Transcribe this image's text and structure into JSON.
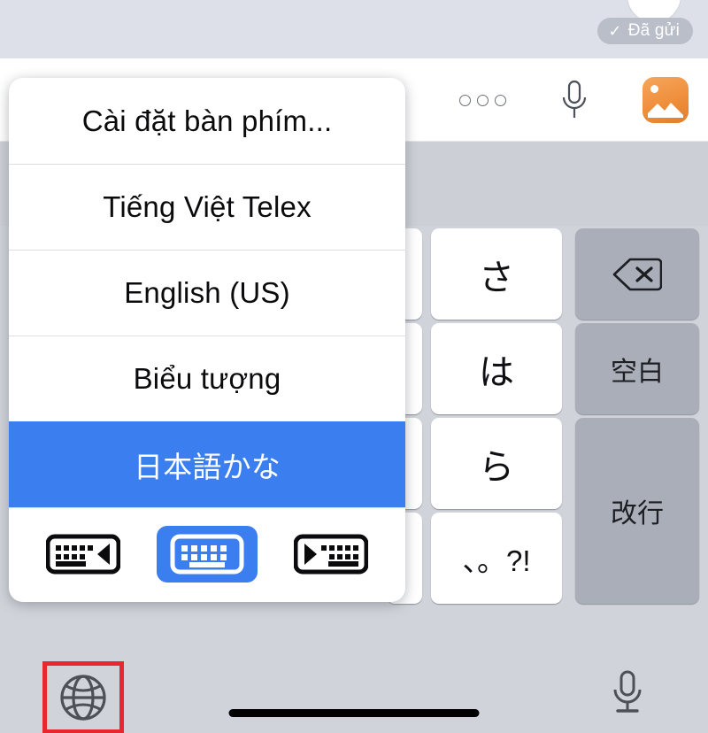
{
  "chat": {
    "status_badge": {
      "check_icon": "check-icon",
      "label": "Đã gửi"
    },
    "avatar": "avatar"
  },
  "toolbar": {
    "more_icon": "more-options-icon",
    "mic_icon": "microphone-icon",
    "photo_icon": "photo-gallery-icon"
  },
  "popup": {
    "items": [
      {
        "label": "Cài đặt bàn phím...",
        "selected": false
      },
      {
        "label": "Tiếng Việt Telex",
        "selected": false
      },
      {
        "label": "English (US)",
        "selected": false
      },
      {
        "label": "Biểu tượng",
        "selected": false
      },
      {
        "label": "日本語かな",
        "selected": true
      }
    ],
    "layout_buttons": [
      {
        "name": "keyboard-dock-left-icon",
        "active": false
      },
      {
        "name": "keyboard-full-icon",
        "active": true
      },
      {
        "name": "keyboard-dock-right-icon",
        "active": false
      }
    ]
  },
  "keyboard": {
    "keys": [
      {
        "label": "さ",
        "name": "key-sa",
        "style": "light"
      },
      {
        "label": "は",
        "name": "key-ha",
        "style": "light"
      },
      {
        "label": "ら",
        "name": "key-ra",
        "style": "light"
      },
      {
        "label": "、。?!",
        "name": "key-punctuation",
        "style": "light"
      },
      {
        "label": "⌫",
        "name": "key-backspace",
        "style": "dark"
      },
      {
        "label": "空白",
        "name": "key-space",
        "style": "dark"
      },
      {
        "label": "改行",
        "name": "key-return",
        "style": "dark"
      }
    ],
    "globe_icon": "globe-icon",
    "dictation_icon": "microphone-icon",
    "home_indicator": "home-indicator"
  },
  "colors": {
    "accent_blue": "#3b7ef0",
    "highlight_red": "#e8262d",
    "keyboard_bg": "#d0d3d9",
    "dark_key": "#a9aeb8",
    "badge_gray": "#b9bec9",
    "photo_orange": "#ef8f3c"
  }
}
